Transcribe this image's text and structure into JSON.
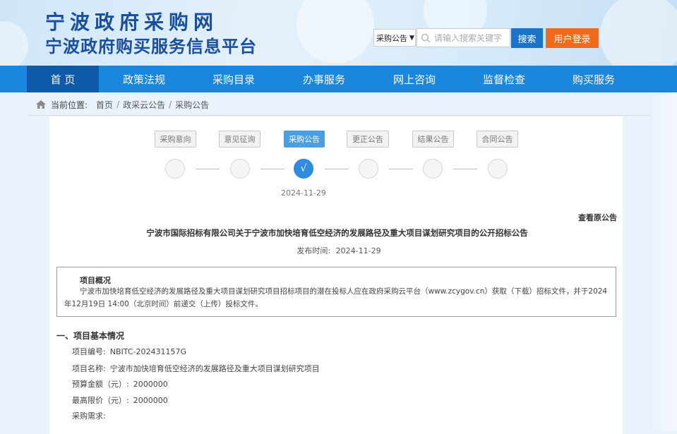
{
  "header": {
    "site_title": "宁波政府采购网",
    "site_subtitle": "宁波政府购买服务信息平台",
    "search_category": "采购公告",
    "search_placeholder": "请输入搜索关键字",
    "search_button": "搜索",
    "login_button": "用户登录"
  },
  "nav": {
    "items": [
      {
        "label": "首 页"
      },
      {
        "label": "政策法规"
      },
      {
        "label": "采购目录"
      },
      {
        "label": "办事服务"
      },
      {
        "label": "网上咨询"
      },
      {
        "label": "监督检查"
      },
      {
        "label": "购买服务"
      }
    ],
    "active_index": 0
  },
  "breadcrumb": {
    "label": "当前位置:",
    "items": [
      "首页",
      "政采云公告",
      "采购公告"
    ]
  },
  "steps": {
    "tabs": [
      "采购意向",
      "意见征询",
      "采购公告",
      "更正公告",
      "结果公告",
      "合同公告"
    ],
    "active_index": 2,
    "check_mark": "√",
    "date": "2024-11-29"
  },
  "document": {
    "view_original": "查看原公告",
    "title": "宁波市国际招标有限公司关于宁波市加快培育低空经济的发展路径及重大项目谋划研究项目的公开招标公告",
    "publish_label": "发布时间:",
    "publish_date": "2024-11-29",
    "overview_title": "项目概况",
    "overview_text": "宁波市加快培育低空经济的发展路径及重大项目谋划研究项目招标项目的潜在投标人应在政府采购云平台（www.zcygov.cn）获取（下载）招标文件，并于2024年12月19日 14:00（北京时间）前递交（上传）投标文件。",
    "section1_title": "一、项目基本情况",
    "fields": [
      {
        "label": "项目编号:",
        "value": "NBITC-202431157G"
      },
      {
        "label": "项目名称:",
        "value": "宁波市加快培育低空经济的发展路径及重大项目谋划研究项目"
      },
      {
        "label": "预算金额（元）:",
        "value": "2000000"
      },
      {
        "label": "最高限价（元）:",
        "value": "2000000"
      },
      {
        "label": "采购需求:",
        "value": ""
      }
    ]
  },
  "colors": {
    "nav_bg": "#1a87dc",
    "nav_active": "#0f5aa8",
    "title_blue": "#1a4fa0",
    "login_orange": "#f26b1d",
    "step_active": "#2e8be0"
  }
}
